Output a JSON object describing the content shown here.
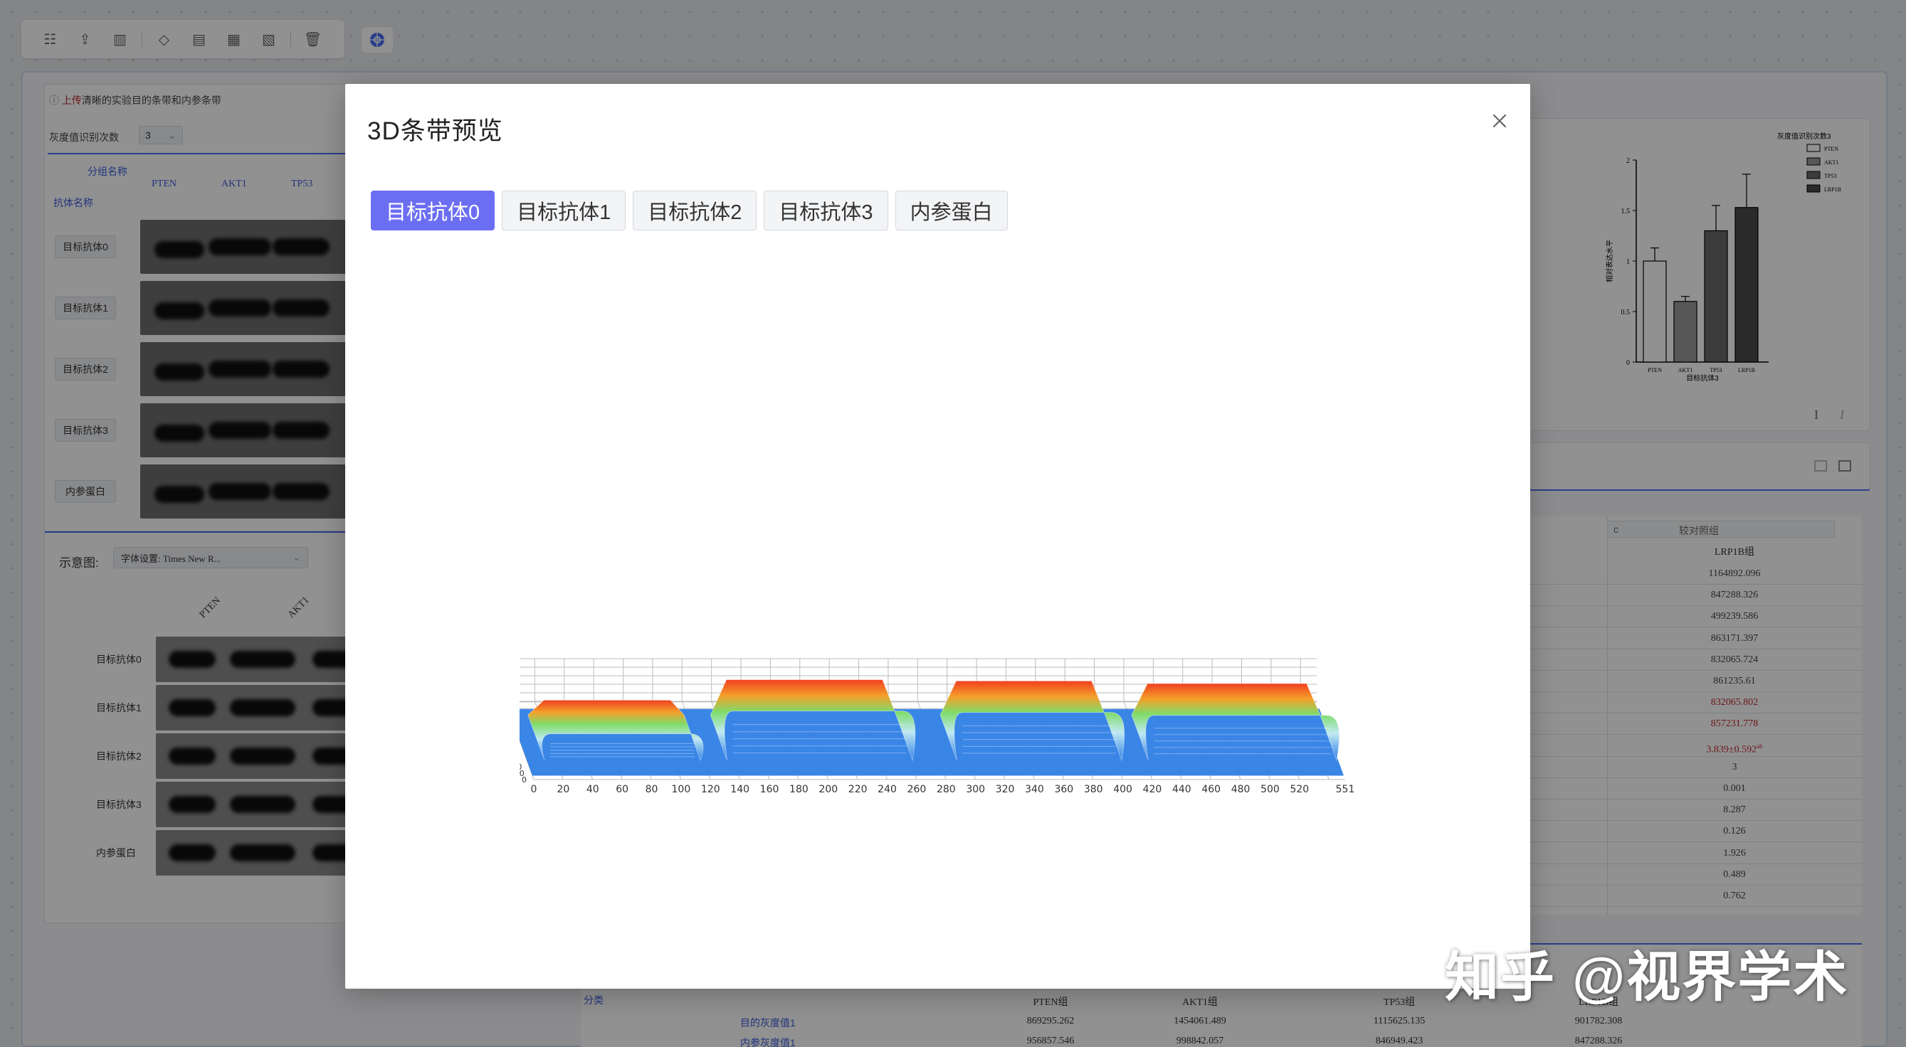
{
  "background": {
    "toolbar_icons": [
      "sort-icon",
      "upload-icon",
      "chart-icon",
      "eye-icon",
      "layout-icon-1",
      "layout-icon-2",
      "layout-icon-3",
      "trash-icon"
    ],
    "globe_icon": "globe-icon",
    "left_panel": {
      "notice_prefix": "上传",
      "notice_rest": "清晰的实验目的条带和内参条带",
      "gray_count_label": "灰度值识别次数",
      "gray_count_value": "3",
      "group_header": "分组名称",
      "antibody_header": "抗体名称",
      "columns": [
        "PTEN",
        "AKT1",
        "TP53"
      ],
      "rows": [
        "目标抗体0",
        "目标抗体1",
        "目标抗体2",
        "目标抗体3",
        "内参蛋白"
      ]
    },
    "schematic": {
      "label": "示意图:",
      "font_select": "字体设置: Times New R...",
      "columns": [
        "PTEN",
        "AKT1"
      ],
      "rows": [
        "目标抗体0",
        "目标抗体1",
        "目标抗体2",
        "目标抗体3",
        "内参蛋白"
      ]
    },
    "bar_chart": {
      "legend_title": "灰度值识别次数3",
      "ylabel": "相对表达水平",
      "xlabel": "目标抗体3",
      "categories": [
        "PTEN",
        "AKT1",
        "TP53",
        "LRP1B"
      ],
      "values": [
        1.0,
        0.6,
        1.3,
        1.53
      ],
      "errors": [
        0.13,
        0.05,
        0.25,
        0.33
      ],
      "yticks": [
        "0",
        "0.5",
        "1",
        "1.5",
        "2"
      ],
      "ylim": [
        0,
        2
      ],
      "colors": [
        "#ffffff",
        "#9a9a9a",
        "#6a6a6a",
        "#4a4a4a"
      ]
    },
    "right_table": {
      "header_control": "c",
      "header_label": "较对照组",
      "column_header": "LRP1B组",
      "values": [
        "1164892.096",
        "847288.326",
        "499239.586",
        "863171.397",
        "832065.724",
        "861235.61",
        "832065.802",
        "857231.778",
        "3.839±0.592",
        "3",
        "0.001",
        "8.287",
        "0.126",
        "1.926",
        "0.489",
        "0.762"
      ],
      "value_superscript": "ab"
    },
    "bottom_table": {
      "col0": "分类",
      "headers": [
        "PTEN组",
        "AKT1组",
        "TP53组",
        "LRP1B组"
      ],
      "rows": [
        {
          "label": "目的灰度值1",
          "cells": [
            "869295.262",
            "1454061.489",
            "1115625.135",
            "901782.308"
          ]
        },
        {
          "label": "内参灰度值1",
          "cells": [
            "956857.546",
            "998842.057",
            "846949.423",
            "847288.326"
          ]
        }
      ]
    }
  },
  "modal": {
    "title": "3D条带预览",
    "close_icon": "close-icon",
    "tabs": [
      "目标抗体0",
      "目标抗体1",
      "目标抗体2",
      "目标抗体3",
      "内参蛋白"
    ],
    "active_tab": 0,
    "plot": {
      "x_ticks": [
        "0",
        "20",
        "40",
        "60",
        "80",
        "100",
        "120",
        "140",
        "160",
        "180",
        "200",
        "220",
        "240",
        "260",
        "280",
        "300",
        "320",
        "340",
        "360",
        "380",
        "400",
        "420",
        "440",
        "460",
        "480",
        "500",
        "520",
        "551"
      ],
      "y_ticks": [
        "0",
        "10",
        "20",
        "30",
        "40",
        "50",
        "60",
        "70",
        "80",
        "90",
        "100",
        "110",
        "121"
      ],
      "colors": {
        "low": "#2f7fe6",
        "mid": "#7fdc6a",
        "high": "#f04020"
      }
    }
  },
  "watermark": "知乎 @视界学术"
}
